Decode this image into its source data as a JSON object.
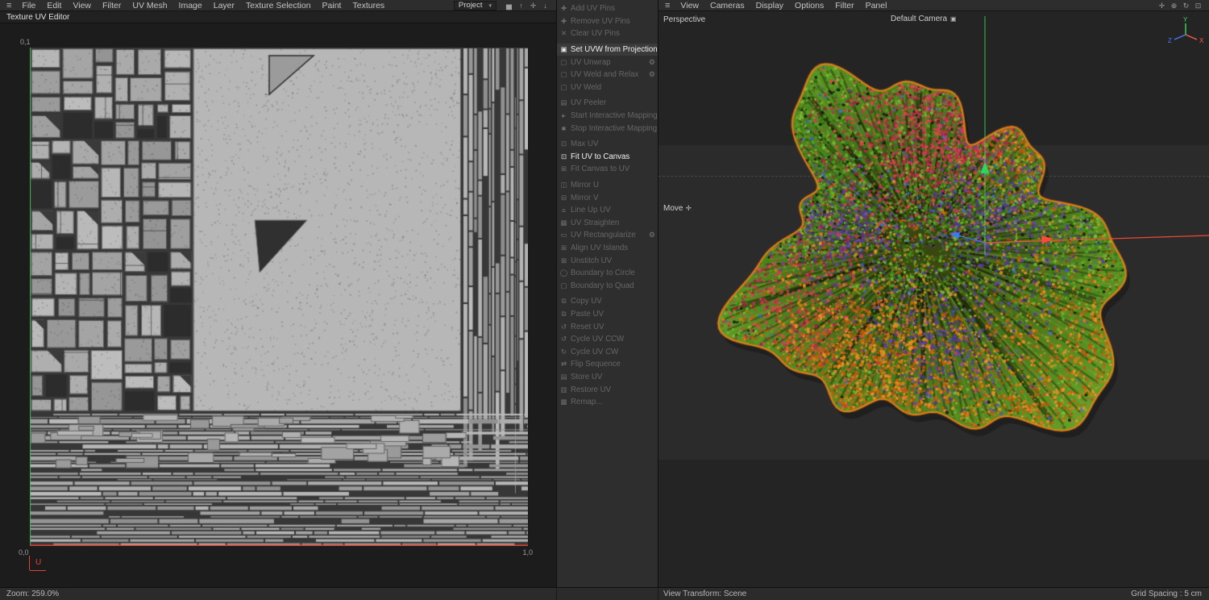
{
  "ui": {
    "hamburger": "≡",
    "caret": "▾",
    "accent_green": "#36c24a",
    "accent_red": "#e04433"
  },
  "left_panel": {
    "menu": [
      "File",
      "Edit",
      "View",
      "Filter",
      "UV Mesh",
      "Image",
      "Layer",
      "Texture Selection",
      "Paint",
      "Textures"
    ],
    "project_dropdown": "Project",
    "toolbar_icons": [
      {
        "name": "histogram-icon",
        "glyph": "▅"
      },
      {
        "name": "arrow-up-icon",
        "glyph": "↑"
      },
      {
        "name": "hand-icon",
        "glyph": "✛"
      },
      {
        "name": "arrow-down-icon",
        "glyph": "↓"
      }
    ],
    "title": "Texture UV Editor",
    "uv_canvas": {
      "corner_top_left": "0,1",
      "corner_bottom_left": "0,0",
      "corner_bottom_right": "1,0",
      "axis_label_u": "U"
    },
    "status_zoom": "Zoom: 259.0%"
  },
  "commands": {
    "gear_glyph": "⚙",
    "items": [
      {
        "label": "Add UV Pins",
        "icon": "✚",
        "enabled": false
      },
      {
        "label": "Remove UV Pins",
        "icon": "✚",
        "enabled": false
      },
      {
        "label": "Clear UV Pins",
        "icon": "✕",
        "enabled": false
      },
      {
        "label": "Set UVW from Projection",
        "icon": "▣",
        "enabled": true,
        "hl_bg": true,
        "gear": true,
        "gap_before": true
      },
      {
        "label": "UV Unwrap",
        "icon": "▢",
        "enabled": false,
        "gear": true
      },
      {
        "label": "UV Weld and Relax",
        "icon": "▢",
        "enabled": false,
        "gear": true
      },
      {
        "label": "UV Weld",
        "icon": "▢",
        "enabled": false
      },
      {
        "label": "UV Peeler",
        "icon": "▤",
        "enabled": false,
        "gap_before": true
      },
      {
        "label": "Start Interactive Mapping",
        "icon": "▸",
        "enabled": false
      },
      {
        "label": "Stop Interactive Mapping",
        "icon": "■",
        "enabled": false
      },
      {
        "label": "Max UV",
        "icon": "⊡",
        "enabled": false,
        "gap_before": true
      },
      {
        "label": "Fit UV to Canvas",
        "icon": "⊡",
        "enabled": true
      },
      {
        "label": "Fit Canvas to UV",
        "icon": "⊞",
        "enabled": false
      },
      {
        "label": "Mirror U",
        "icon": "◫",
        "enabled": false,
        "gap_before": true
      },
      {
        "label": "Mirror V",
        "icon": "⊟",
        "enabled": false
      },
      {
        "label": "Line Up UV",
        "icon": "≡",
        "enabled": false
      },
      {
        "label": "UV Straighten",
        "icon": "▦",
        "enabled": false
      },
      {
        "label": "UV Rectangularize",
        "icon": "▭",
        "enabled": false,
        "gear": true
      },
      {
        "label": "Align UV Islands",
        "icon": "⊞",
        "enabled": false
      },
      {
        "label": "Unstitch UV",
        "icon": "⊠",
        "enabled": false
      },
      {
        "label": "Boundary to Circle",
        "icon": "◯",
        "enabled": false
      },
      {
        "label": "Boundary to Quad",
        "icon": "▢",
        "enabled": false
      },
      {
        "label": "Copy UV",
        "icon": "⧉",
        "enabled": false,
        "gap_before": true
      },
      {
        "label": "Paste UV",
        "icon": "⧉",
        "enabled": false
      },
      {
        "label": "Reset UV",
        "icon": "↺",
        "enabled": false
      },
      {
        "label": "Cycle UV CCW",
        "icon": "↺",
        "enabled": false
      },
      {
        "label": "Cycle UV CW",
        "icon": "↻",
        "enabled": false
      },
      {
        "label": "Flip Sequence",
        "icon": "⇄",
        "enabled": false
      },
      {
        "label": "Store UV",
        "icon": "▤",
        "enabled": false
      },
      {
        "label": "Restore UV",
        "icon": "▥",
        "enabled": false
      },
      {
        "label": "Remap...",
        "icon": "▩",
        "enabled": false
      }
    ]
  },
  "viewport": {
    "menu": [
      "View",
      "Cameras",
      "Display",
      "Options",
      "Filter",
      "Panel"
    ],
    "view_icons": [
      {
        "name": "pan-view-icon",
        "glyph": "✛"
      },
      {
        "name": "zoom-view-icon",
        "glyph": "⊕"
      },
      {
        "name": "rotate-view-icon",
        "glyph": "↻"
      },
      {
        "name": "toggle-view-icon",
        "glyph": "⊡"
      }
    ],
    "perspective_label": "Perspective",
    "camera_label": "Default Camera",
    "camera_icon": "▣",
    "tool_label": "Move",
    "tool_icon": "✛",
    "axis_labels": {
      "x": "X",
      "y": "Y",
      "z": "Z"
    },
    "status_left": "View Transform: Scene",
    "status_right": "Grid Spacing : 5 cm"
  }
}
